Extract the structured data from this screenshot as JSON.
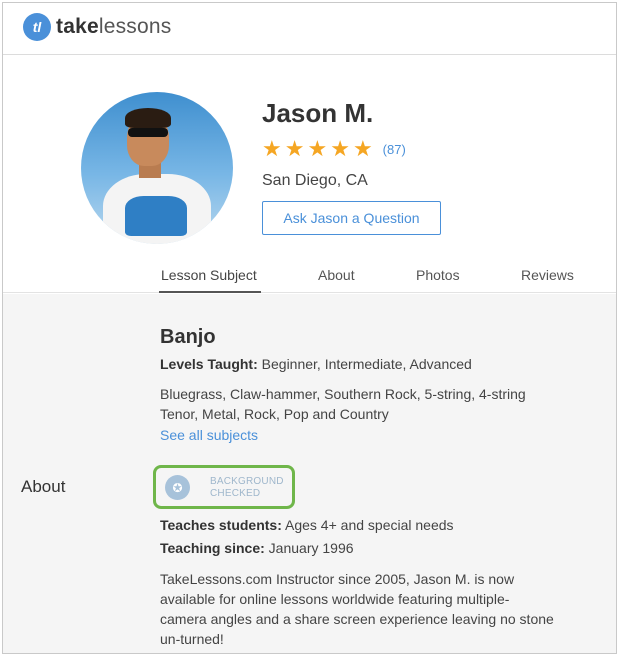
{
  "brand": {
    "mark": "tl",
    "name_bold": "take",
    "name_rest": "lessons"
  },
  "profile": {
    "name": "Jason M.",
    "rating_stars": 5,
    "review_count": "(87)",
    "location": "San Diego, CA",
    "ask_button": "Ask Jason a Question"
  },
  "tabs": [
    {
      "label": "Lesson Subject",
      "active": true
    },
    {
      "label": "About",
      "active": false
    },
    {
      "label": "Photos",
      "active": false
    },
    {
      "label": "Reviews",
      "active": false
    }
  ],
  "content": {
    "section_label": "About",
    "subject": "Banjo",
    "levels_label": "Levels Taught:",
    "levels_value": " Beginner, Intermediate, Advanced",
    "styles": "Bluegrass, Claw-hammer, Southern Rock, 5-string, 4-string Tenor, Metal, Rock, Pop and Country",
    "see_all": "See all subjects",
    "badge_line1": "BACKGROUND",
    "badge_line2": "CHECKED",
    "teaches_label": "Teaches students:",
    "teaches_value": " Ages 4+ and special needs",
    "since_label": "Teaching since:",
    "since_value": " January 1996",
    "description": "TakeLessons.com Instructor since 2005, Jason M. is now available for online lessons worldwide featuring multiple-camera angles and a share screen experience leaving no stone un-turned!"
  },
  "colors": {
    "accent": "#4a90d9",
    "star": "#f5a623",
    "badge_border": "#6fb64a"
  }
}
